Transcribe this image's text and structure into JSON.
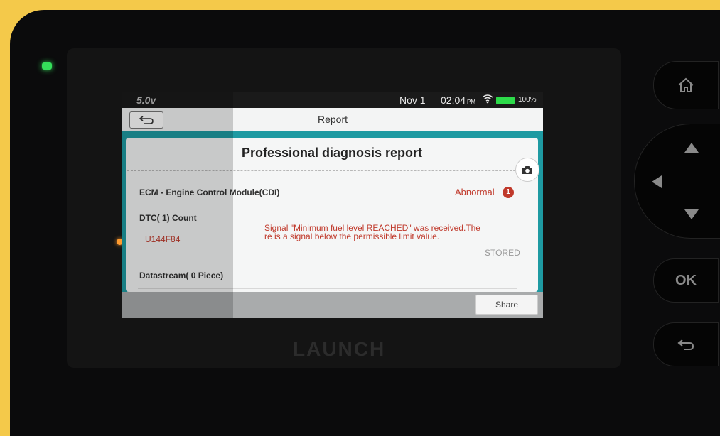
{
  "device": {
    "brand": "LAUNCH",
    "ok_label": "OK"
  },
  "statusbar": {
    "voltage": "5.0v",
    "date": "Nov 1",
    "time": "02:04",
    "ampm": "PM",
    "battery": "100%"
  },
  "titlebar": {
    "title": "Report"
  },
  "report": {
    "title": "Professional diagnosis report",
    "module": "ECM - Engine Control Module(CDI)",
    "status": "Abnormal",
    "status_count": "1",
    "dtc_count_label": "DTC( 1) Count",
    "dtc": {
      "code": "U144F84",
      "description_line1": "Signal \"Minimum fuel level REACHED\" was received.The",
      "description_line2": "re is a signal below the permissible limit value.",
      "state": "STORED"
    },
    "datastream_label": "Datastream( 0 Piece)"
  },
  "footer": {
    "share_label": "Share"
  },
  "colors": {
    "accent": "#1e9aa2",
    "error": "#c0392b",
    "frame": "#f4c94a"
  },
  "icons": [
    "back-arrow-icon",
    "camera-icon",
    "wifi-icon",
    "battery-icon",
    "home-icon",
    "dpad-up-icon",
    "dpad-left-icon",
    "dpad-down-icon",
    "return-icon"
  ]
}
